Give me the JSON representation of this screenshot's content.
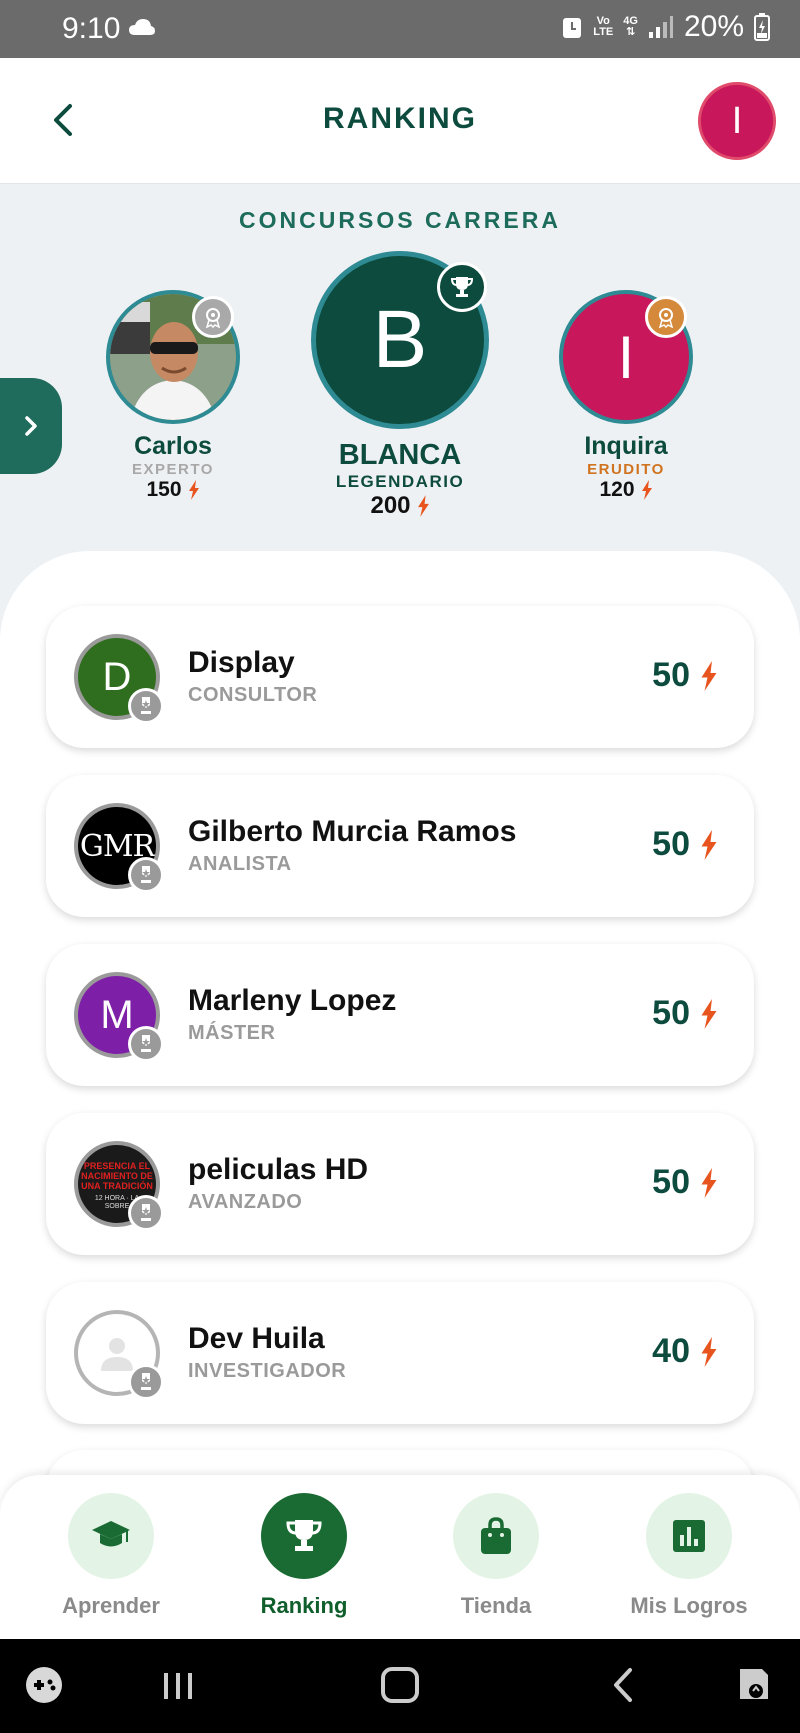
{
  "status_bar": {
    "time": "9:10",
    "net_top": "Vo",
    "net_bottom": "LTE",
    "gen": "4G",
    "battery": "20%"
  },
  "header": {
    "title": "RANKING",
    "profile_initial": "I"
  },
  "contest": {
    "title": "CONCURSOS CARRERA"
  },
  "podium": [
    {
      "name": "Carlos",
      "level": "EXPERTO",
      "points": "150",
      "level_color": "#a8a8a8",
      "medal_color": "#a9a9a9"
    },
    {
      "name": "BLANCA",
      "initial": "B",
      "level": "LEGENDARIO",
      "points": "200",
      "level_color": "#0c4b3d",
      "medal_color": "#0c4b3d"
    },
    {
      "name": "Inquira",
      "initial": "I",
      "level": "ERUDITO",
      "points": "120",
      "level_color": "#d0731f",
      "medal_color": "#d4893b"
    }
  ],
  "ranking": [
    {
      "name": "Display",
      "initial": "D",
      "level": "CONSULTOR",
      "points": "50",
      "avatar_color": "#2f6e1e"
    },
    {
      "name": "Gilberto Murcia Ramos",
      "initial": "GMR",
      "level": "ANALISTA",
      "points": "50",
      "avatar_color": "#000000"
    },
    {
      "name": "Marleny Lopez",
      "initial": "M",
      "level": "MÁSTER",
      "points": "50",
      "avatar_color": "#7e1fa7"
    },
    {
      "name": "peliculas HD",
      "level": "AVANZADO",
      "points": "50",
      "avatar_color": "#1a1a1a",
      "avatar_text": "PRESENCIA EL NACIMIENTO DE UNA TRADICIÓN",
      "avatar_text2": "12 HORA · LA SOBRE"
    },
    {
      "name": "Dev Huila",
      "level": "INVESTIGADOR",
      "points": "40",
      "avatar_color": "#ffffff"
    }
  ],
  "bottom_nav": [
    {
      "label": "Aprender",
      "icon": "graduation-cap-icon"
    },
    {
      "label": "Ranking",
      "icon": "trophy-icon",
      "active": true
    },
    {
      "label": "Tienda",
      "icon": "shopping-bag-icon"
    },
    {
      "label": "Mis Logros",
      "icon": "bar-chart-icon"
    }
  ],
  "colors": {
    "primary": "#0c4b3d",
    "accent_bolt": "#e8541e",
    "active_nav": "#1a6b33"
  }
}
